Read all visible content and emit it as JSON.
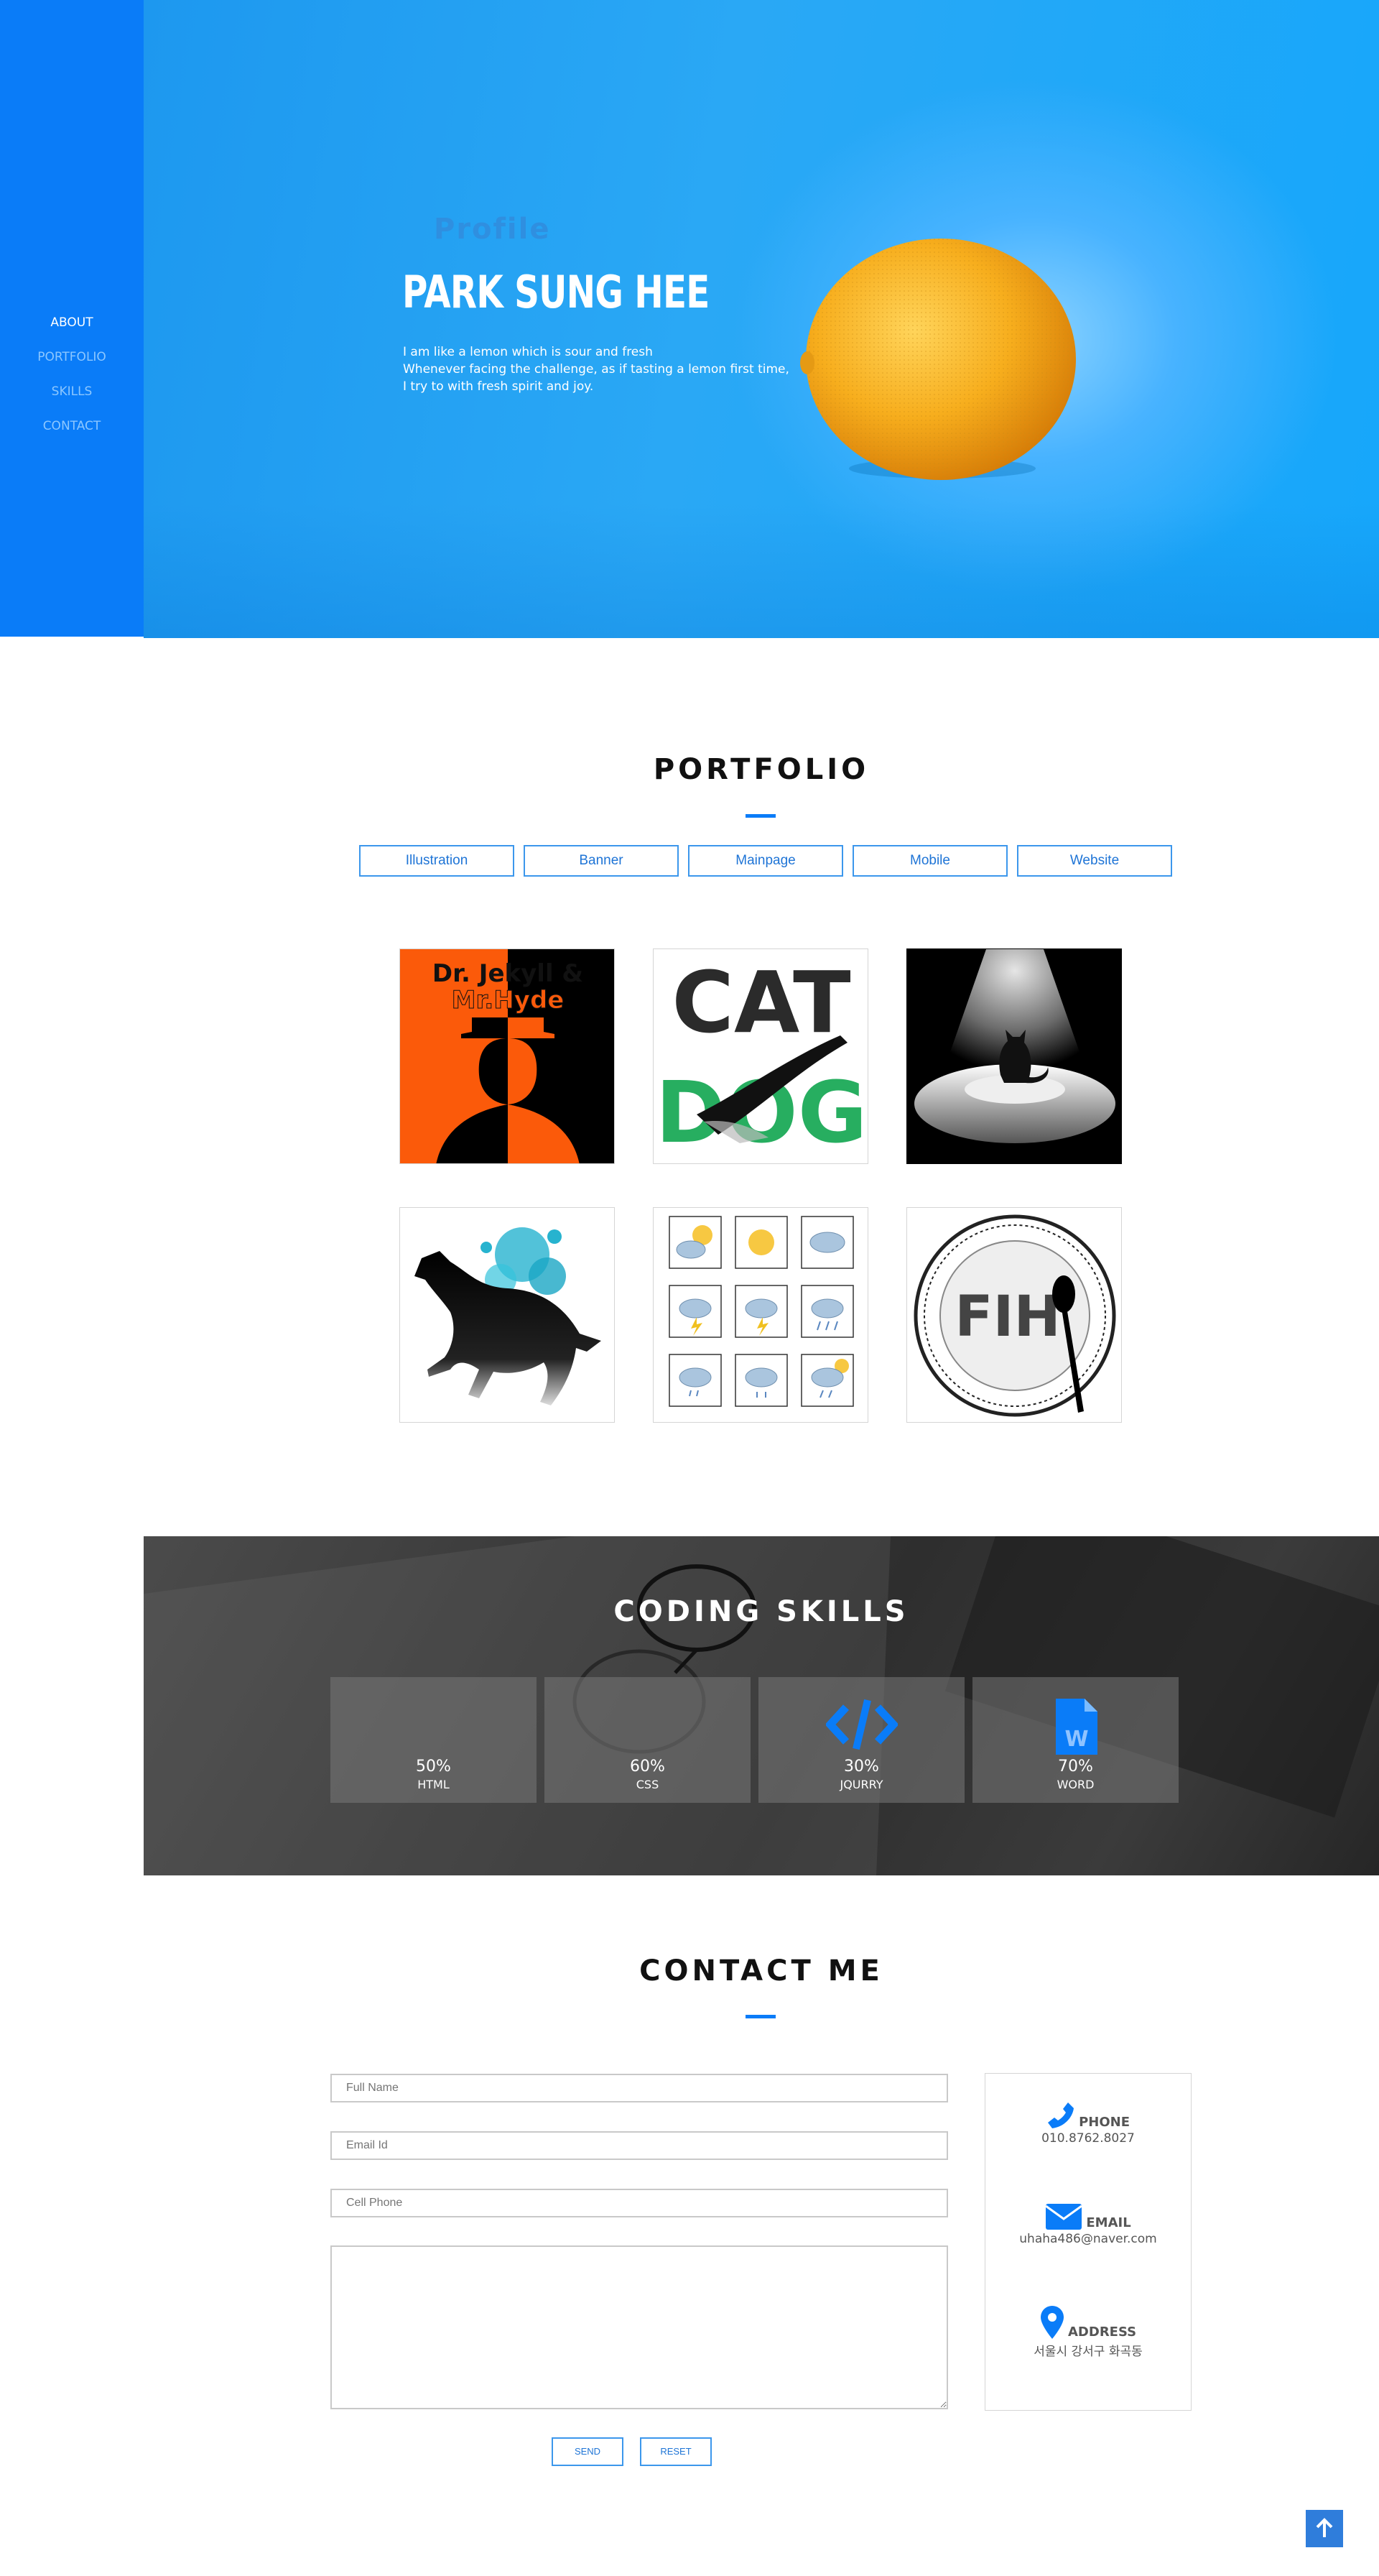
{
  "nav": {
    "items": [
      "ABOUT",
      "PORTFOLIO",
      "SKILLS",
      "CONTACT"
    ]
  },
  "hero": {
    "label": "Profile",
    "name": "PARK SUNG HEE",
    "lines": [
      "I am like a lemon which is sour and fresh",
      "Whenever facing the challenge, as if tasting a lemon first time,",
      "I try to with fresh spirit and joy."
    ]
  },
  "portfolio": {
    "title": "PORTFOLIO",
    "filters": [
      "Illustration",
      "Banner",
      "Mainpage",
      "Mobile",
      "Website"
    ],
    "tiles": {
      "jekyll_line1": "Dr. Jekyll &",
      "jekyll_line2": "Mr.Hyde",
      "cat": "CAT",
      "dog": "DOG",
      "fish": "FIH"
    }
  },
  "skills": {
    "title": "CODING SKILLS",
    "items": [
      {
        "pct": "50%",
        "name": "HTML",
        "value": 50
      },
      {
        "pct": "60%",
        "name": "CSS",
        "value": 60
      },
      {
        "pct": "30%",
        "name": "JQURRY",
        "value": 30
      },
      {
        "pct": "70%",
        "name": "WORD",
        "value": 70
      }
    ]
  },
  "contact": {
    "title": "CONTACT ME",
    "placeholders": {
      "name": "Full Name",
      "email": "Email Id",
      "phone": "Cell Phone"
    },
    "send": "SEND",
    "reset": "RESET",
    "info": [
      {
        "icon": "phone-icon",
        "label": "PHONE",
        "value": "010.8762.8027"
      },
      {
        "icon": "mail-icon",
        "label": "EMAIL",
        "value": "uhaha486@naver.com"
      },
      {
        "icon": "location-pin-icon",
        "label": "ADDRESS",
        "value": "서울시 강서구 화곡동"
      }
    ]
  },
  "colors": {
    "accent": "#0a7cf8",
    "hero": "#2aa8f5",
    "skills_bg": "#3a3a3a"
  }
}
